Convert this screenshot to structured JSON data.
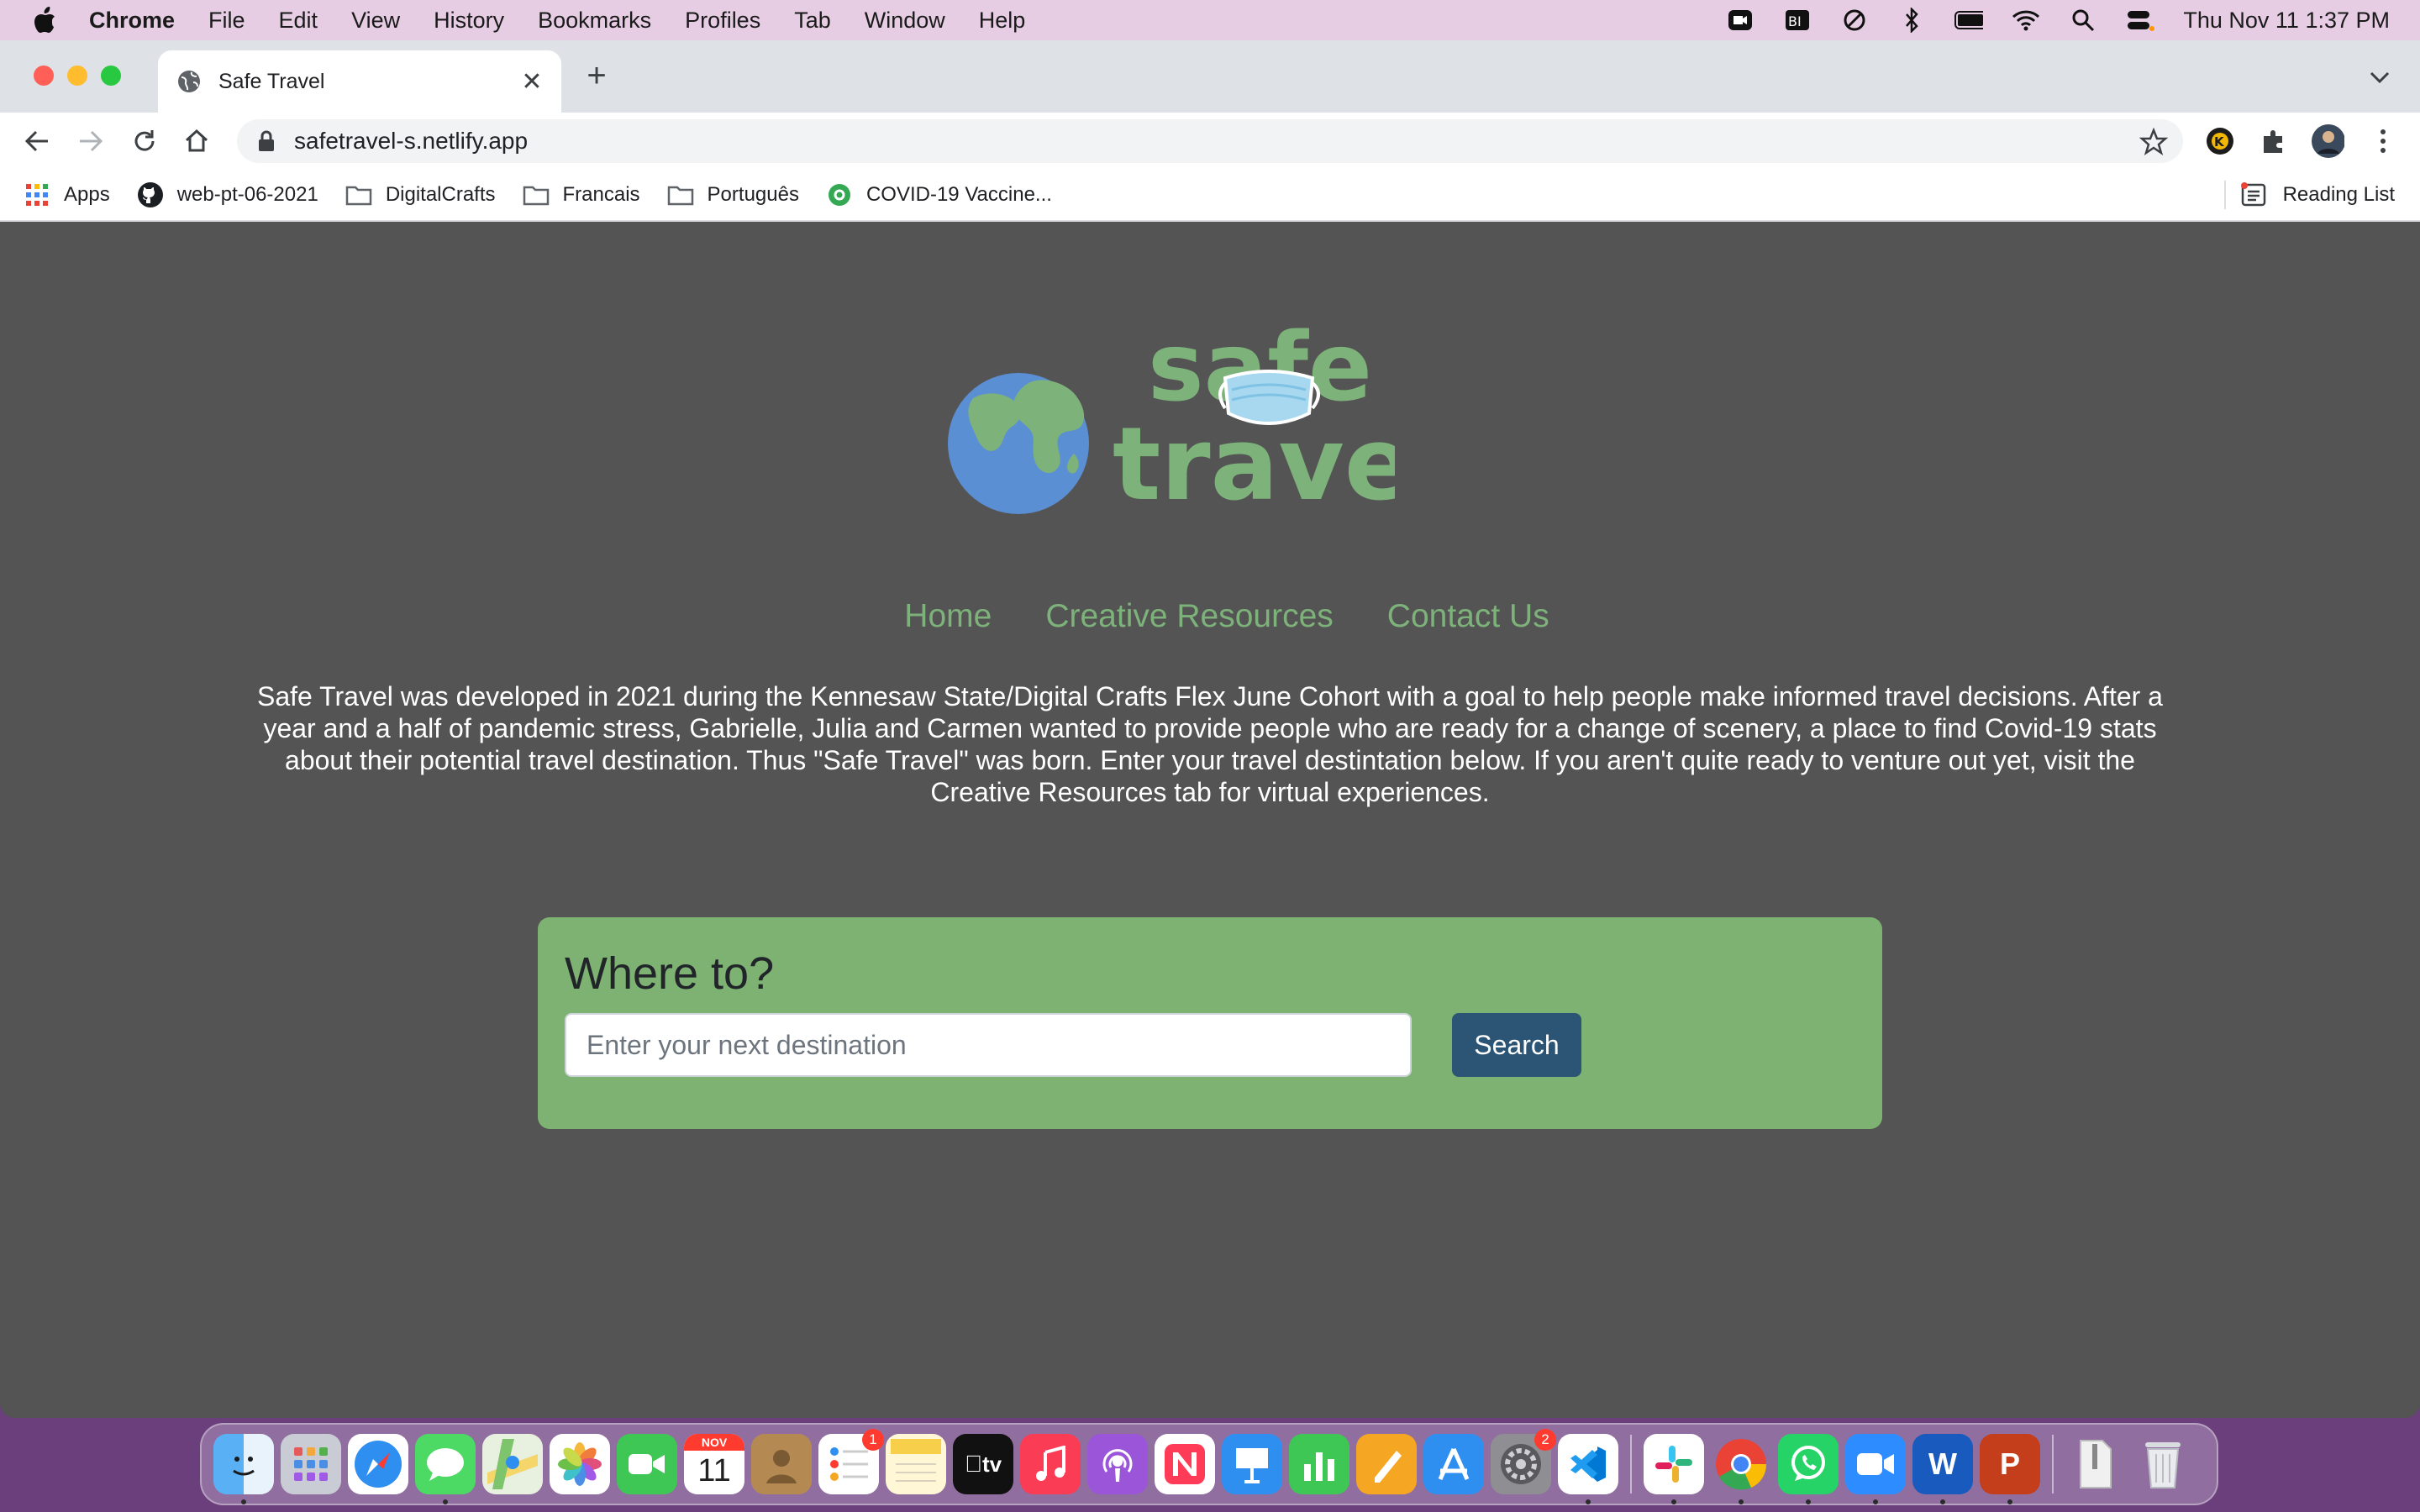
{
  "menubar": {
    "items": [
      "Chrome",
      "File",
      "Edit",
      "View",
      "History",
      "Bookmarks",
      "Profiles",
      "Tab",
      "Window",
      "Help"
    ],
    "datetime": "Thu Nov 11  1:37 PM"
  },
  "browser": {
    "tab_title": "Safe Travel",
    "url": "safetravel-s.netlify.app",
    "bookmarks": [
      "Apps",
      "web-pt-06-2021",
      "DigitalCrafts",
      "Francais",
      "Português",
      "COVID-19 Vaccine..."
    ],
    "reading_list": "Reading List"
  },
  "site": {
    "logo_text_1": "safe",
    "logo_text_2": "travel",
    "nav": [
      "Home",
      "Creative Resources",
      "Contact Us"
    ],
    "intro": "Safe Travel was developed in 2021 during the Kennesaw State/Digital Crafts Flex June Cohort with a goal to help people make informed travel decisions. After a year and a half of pandemic stress, Gabrielle, Julia and Carmen wanted to provide people who are ready for a change of scenery, a place to find Covid-19 stats about their potential travel destination. Thus \"Safe Travel\" was born. Enter your travel destintation below. If you aren't quite ready to venture out yet, visit the Creative Resources tab for virtual experiences.",
    "search": {
      "heading": "Where to?",
      "placeholder": "Enter your next destination",
      "button": "Search"
    }
  },
  "dock": {
    "calendar_month": "NOV",
    "calendar_day": "11",
    "reminders_badge": "1",
    "settings_badge": "2",
    "tv_label": "tv"
  },
  "colors": {
    "page_bg": "#545454",
    "brand_green": "#7db27a",
    "search_card": "#7db272",
    "button_blue": "#2c5575",
    "earth_blue": "#5b8fd4"
  }
}
